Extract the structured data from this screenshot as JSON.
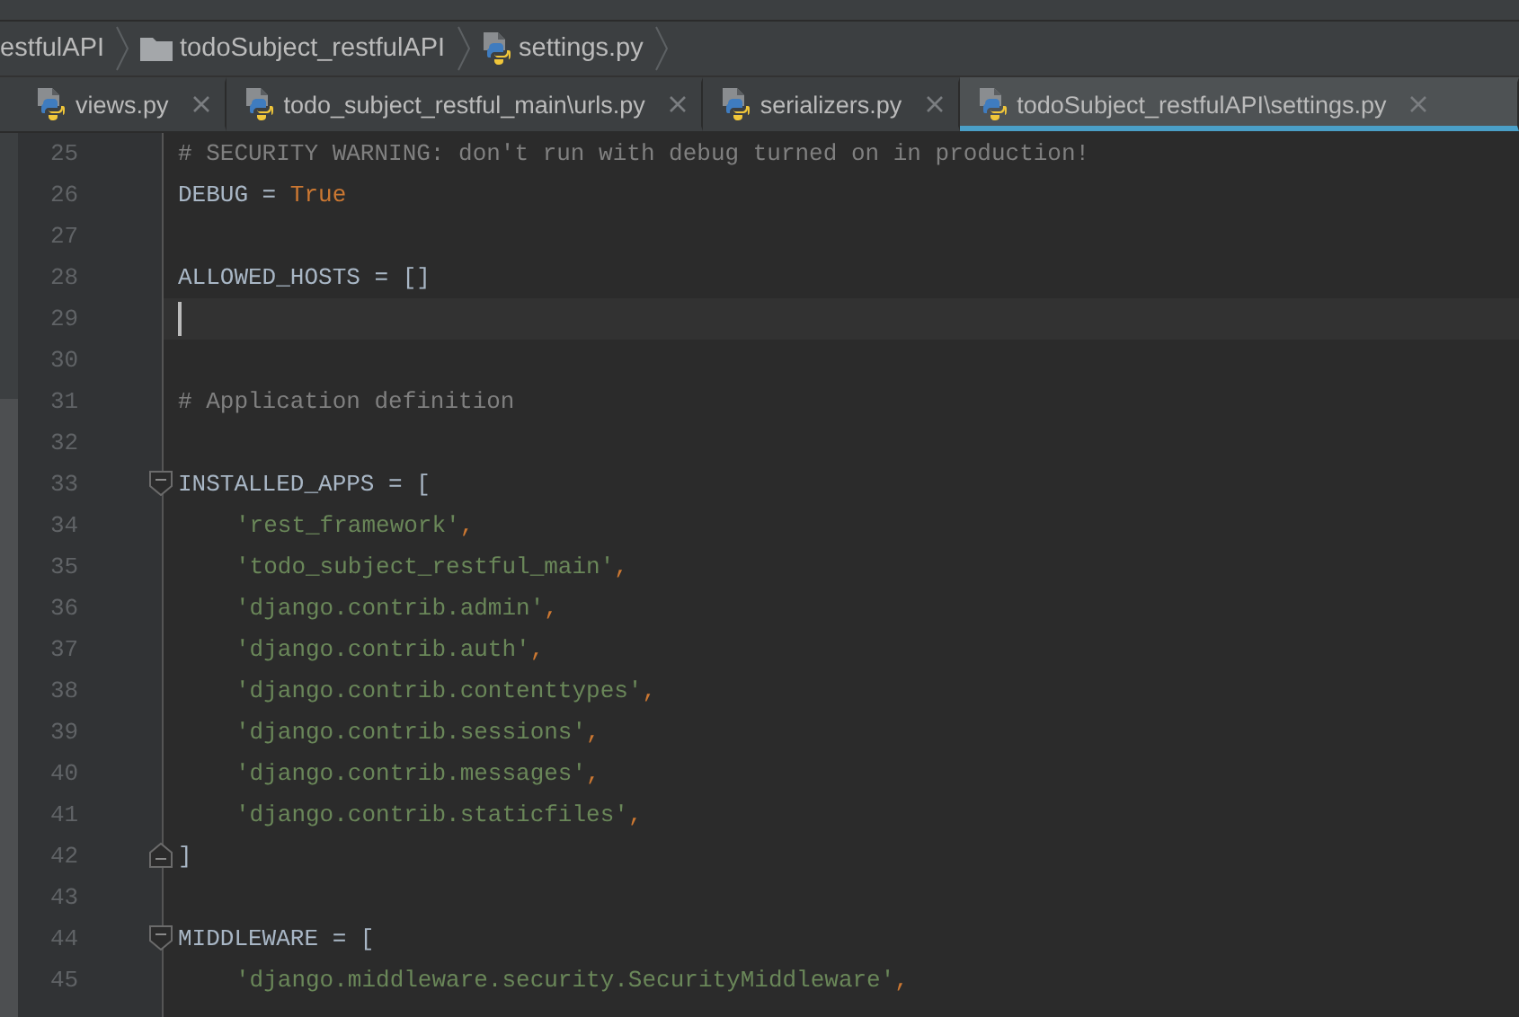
{
  "breadcrumbs": [
    {
      "label": "estfulAPI",
      "kind": "text"
    },
    {
      "label": "todoSubject_restfulAPI",
      "kind": "folder"
    },
    {
      "label": "settings.py",
      "kind": "python"
    }
  ],
  "tabs": [
    {
      "label": "views.py",
      "selected": false
    },
    {
      "label": "todo_subject_restful_main\\urls.py",
      "selected": false
    },
    {
      "label": "serializers.py",
      "selected": false
    },
    {
      "label": "todoSubject_restfulAPI\\settings.py",
      "selected": true
    }
  ],
  "editor": {
    "lines": [
      {
        "number": "25",
        "tokens": [
          {
            "kind": "comment",
            "text": "# SECURITY WARNING: don't run with debug turned on in production!"
          }
        ]
      },
      {
        "number": "26",
        "tokens": [
          {
            "kind": "plain",
            "text": "DEBUG = "
          },
          {
            "kind": "keyword",
            "text": "True"
          }
        ]
      },
      {
        "number": "27"
      },
      {
        "number": "28",
        "tokens": [
          {
            "kind": "plain",
            "text": "ALLOWED_HOSTS = []"
          }
        ]
      },
      {
        "number": "29",
        "current": true
      },
      {
        "number": "30"
      },
      {
        "number": "31",
        "tokens": [
          {
            "kind": "comment",
            "text": "# Application definition"
          }
        ]
      },
      {
        "number": "32"
      },
      {
        "number": "33",
        "fold_start": true,
        "tokens": [
          {
            "kind": "plain",
            "text": "INSTALLED_APPS = ["
          }
        ]
      },
      {
        "number": "34",
        "indent": true,
        "tokens": [
          {
            "kind": "string",
            "text": "'rest_framework'"
          },
          {
            "kind": "keyword",
            "text": ","
          }
        ]
      },
      {
        "number": "35",
        "indent": true,
        "tokens": [
          {
            "kind": "string",
            "text": "'todo_subject_restful_main'"
          },
          {
            "kind": "keyword",
            "text": ","
          }
        ]
      },
      {
        "number": "36",
        "indent": true,
        "tokens": [
          {
            "kind": "string",
            "text": "'django.contrib.admin'"
          },
          {
            "kind": "keyword",
            "text": ","
          }
        ]
      },
      {
        "number": "37",
        "indent": true,
        "tokens": [
          {
            "kind": "string",
            "text": "'django.contrib.auth'"
          },
          {
            "kind": "keyword",
            "text": ","
          }
        ]
      },
      {
        "number": "38",
        "indent": true,
        "tokens": [
          {
            "kind": "string",
            "text": "'django.contrib.contenttypes'"
          },
          {
            "kind": "keyword",
            "text": ","
          }
        ]
      },
      {
        "number": "39",
        "indent": true,
        "tokens": [
          {
            "kind": "string",
            "text": "'django.contrib.sessions'"
          },
          {
            "kind": "keyword",
            "text": ","
          }
        ]
      },
      {
        "number": "40",
        "indent": true,
        "tokens": [
          {
            "kind": "string",
            "text": "'django.contrib.messages'"
          },
          {
            "kind": "keyword",
            "text": ","
          }
        ]
      },
      {
        "number": "41",
        "indent": true,
        "tokens": [
          {
            "kind": "string",
            "text": "'django.contrib.staticfiles'"
          },
          {
            "kind": "keyword",
            "text": ","
          }
        ]
      },
      {
        "number": "42",
        "fold_end": true,
        "tokens": [
          {
            "kind": "plain",
            "text": "]"
          }
        ]
      },
      {
        "number": "43"
      },
      {
        "number": "44",
        "fold_start": true,
        "tokens": [
          {
            "kind": "plain",
            "text": "MIDDLEWARE = ["
          }
        ]
      },
      {
        "number": "45",
        "indent": true,
        "tokens": [
          {
            "kind": "string",
            "text": "'django.middleware.security.SecurityMiddleware'"
          },
          {
            "kind": "keyword",
            "text": ","
          }
        ]
      }
    ]
  }
}
